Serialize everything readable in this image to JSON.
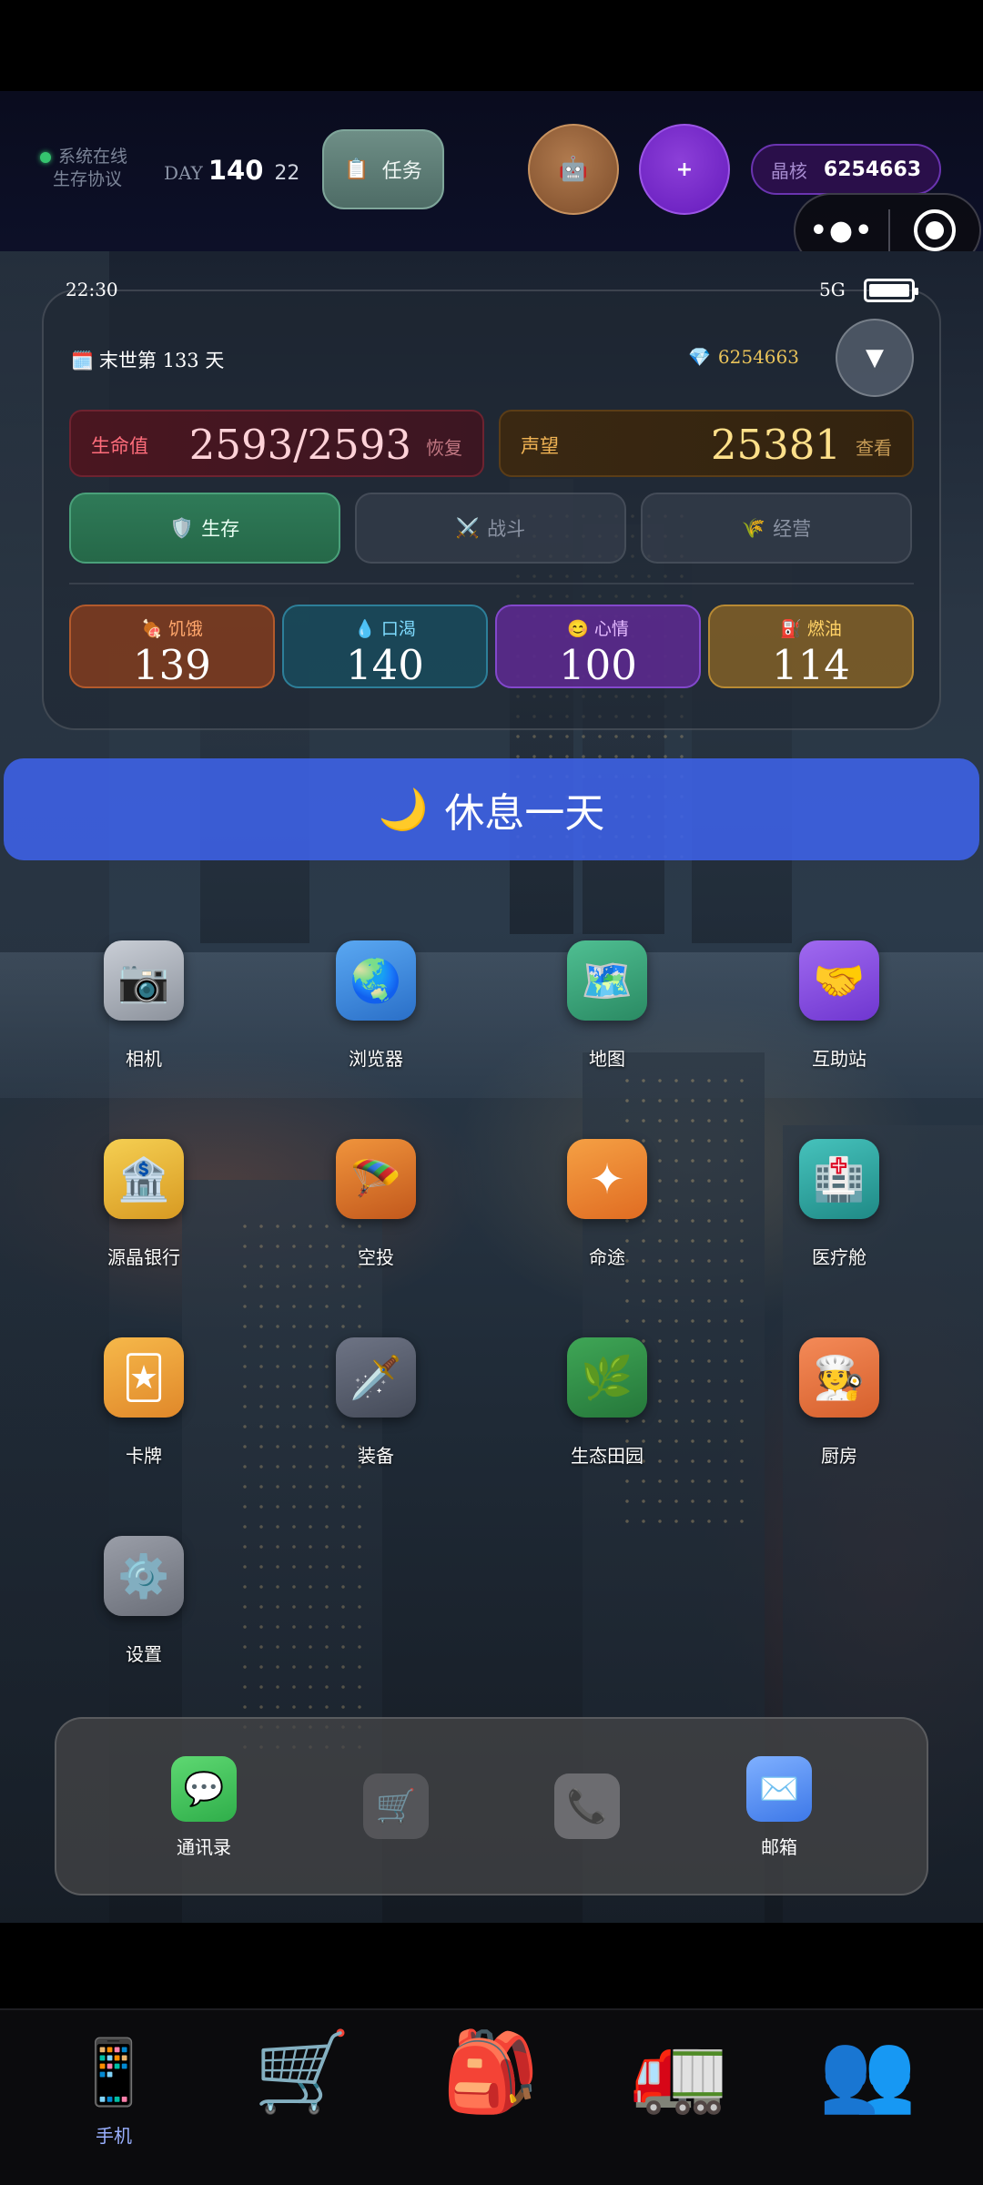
{
  "header": {
    "system_status": "系统在线",
    "protocol": "生存协议",
    "day_label": "DAY",
    "day_number": "140",
    "day_sub": "22",
    "task_label": "任务",
    "task_icon": "📋",
    "robot_icon": "🤖",
    "plus_label": "+",
    "crystal_label": "晶核",
    "crystal_value": "6254663",
    "more_glyph": "•●•"
  },
  "card": {
    "time": "22:30",
    "network": "5G",
    "doom_icon": "🗓️",
    "doom_day": "末世第 133 天",
    "gem_icon": "💎",
    "gem_value": "6254663",
    "dropdown_icon": "▼",
    "hp": {
      "label": "生命值",
      "value": "2593/2593",
      "action": "恢复"
    },
    "reputation": {
      "label": "声望",
      "value": "25381",
      "action": "查看"
    },
    "tabs": [
      {
        "icon": "🛡️",
        "label": "生存"
      },
      {
        "icon": "⚔️",
        "label": "战斗"
      },
      {
        "icon": "🌾",
        "label": "经营"
      }
    ],
    "needs": [
      {
        "icon": "🍖",
        "label": "饥饿",
        "value": "139"
      },
      {
        "icon": "💧",
        "label": "口渴",
        "value": "140"
      },
      {
        "icon": "😊",
        "label": "心情",
        "value": "100"
      },
      {
        "icon": "⛽",
        "label": "燃油",
        "value": "114"
      }
    ]
  },
  "rest_button": {
    "icon": "🌙",
    "label": "休息一天"
  },
  "apps": [
    {
      "icon": "📷",
      "label": "相机",
      "color": "#9aa0ab"
    },
    {
      "icon": "🌏",
      "label": "浏览器",
      "color": "#3c8fe0"
    },
    {
      "icon": "🗺️",
      "label": "地图",
      "color": "#3aa37a"
    },
    {
      "icon": "🤝",
      "label": "互助站",
      "color": "#8a4fe0"
    },
    {
      "icon": "🏦",
      "label": "源晶银行",
      "color": "#e8b93a"
    },
    {
      "icon": "🪂",
      "label": "空投",
      "color": "#e07a2a"
    },
    {
      "icon": "✦",
      "label": "命途",
      "color": "#ef8b2e"
    },
    {
      "icon": "🏥",
      "label": "医疗舱",
      "color": "#2fa7a3"
    },
    {
      "icon": "🃏",
      "label": "卡牌",
      "color": "#f0a83a"
    },
    {
      "icon": "🗡️",
      "label": "装备",
      "color": "#5b6070"
    },
    {
      "icon": "🌿",
      "label": "生态田园",
      "color": "#2f8a45"
    },
    {
      "icon": "🧑‍🍳",
      "label": "厨房",
      "color": "#f07a44"
    },
    {
      "icon": "⚙️",
      "label": "设置",
      "color": "#7c8088"
    }
  ],
  "dock": [
    {
      "icon": "💬",
      "label": "通讯录",
      "color": "#3fc35a"
    },
    {
      "icon": "🛒",
      "label": "",
      "color": "#6c6c6e"
    },
    {
      "icon": "📞",
      "label": "",
      "color": "#6c6c6e"
    },
    {
      "icon": "✉️",
      "label": "邮箱",
      "color": "#4d8cf0"
    }
  ],
  "bottom_nav": [
    {
      "icon": "📱",
      "label": "手机"
    },
    {
      "icon": "🛒",
      "label": ""
    },
    {
      "icon": "🎒",
      "label": ""
    },
    {
      "icon": "🚛",
      "label": ""
    },
    {
      "icon": "👥",
      "label": ""
    }
  ],
  "colors": {
    "accent_blue": "#3e62e8",
    "hp_red": "#ff6d7b",
    "reputation_gold": "#ffe08a",
    "active_tab_green": "#2f7a58"
  }
}
